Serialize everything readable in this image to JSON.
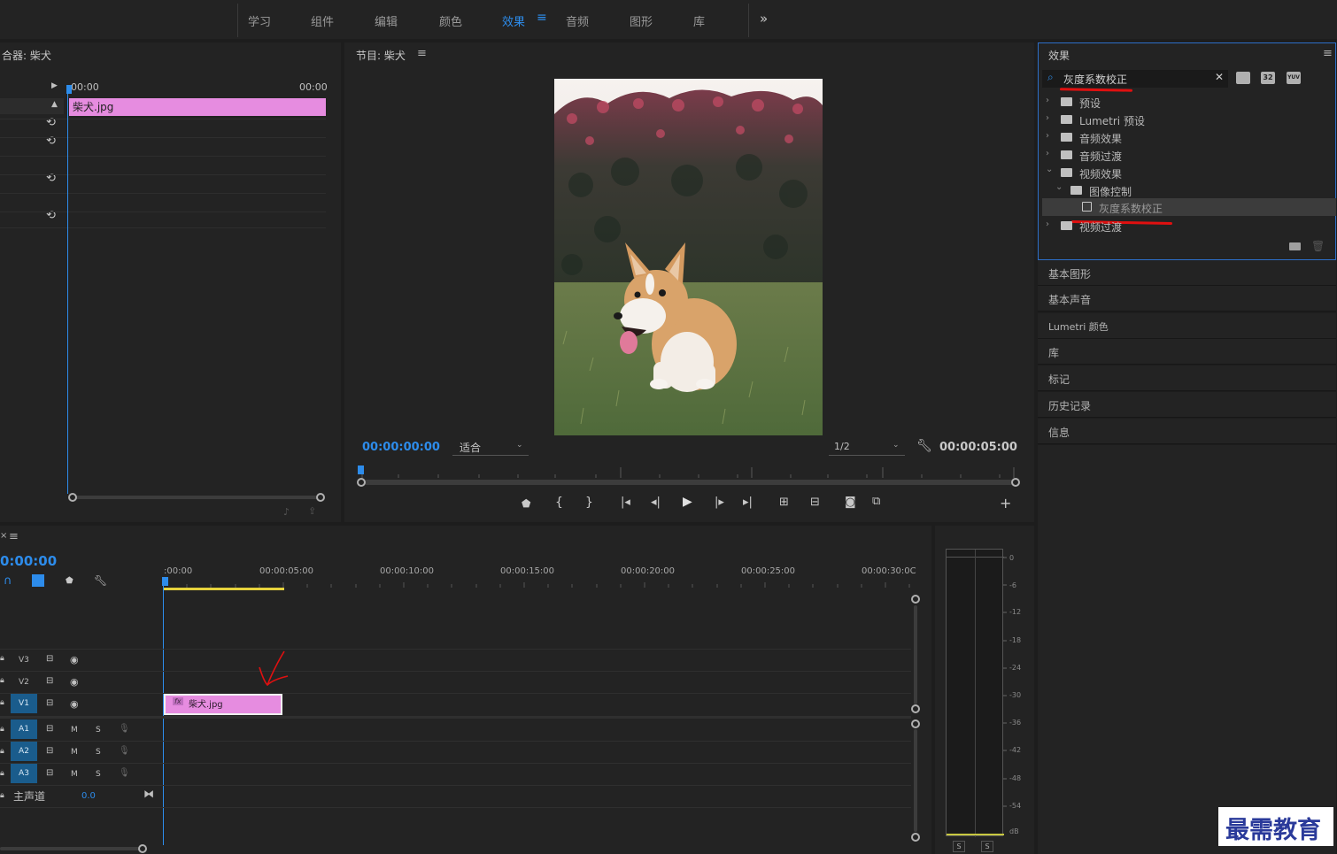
{
  "workspaces": [
    "学习",
    "组件",
    "编辑",
    "颜色",
    "效果",
    "音频",
    "图形",
    "库"
  ],
  "workspace_active_index": 4,
  "workspace_more": "»",
  "effect_controls": {
    "title": "合器: 柴犬",
    "time_left": "00:00",
    "time_right": "00:00",
    "clip_name": "柴犬.jpg"
  },
  "program": {
    "title": "节目: 柴犬",
    "timecode": "00:00:00:00",
    "fit": "适合",
    "resolution": "1/2",
    "duration": "00:00:05:00"
  },
  "effects_panel": {
    "title": "效果",
    "search_value": "灰度系数校正",
    "badge_32": "32",
    "badge_yuv": "YUV",
    "tree": [
      {
        "label": "预设",
        "level": 0,
        "expanded": false
      },
      {
        "label": "Lumetri 预设",
        "level": 0,
        "expanded": false
      },
      {
        "label": "音频效果",
        "level": 0,
        "expanded": false
      },
      {
        "label": "音频过渡",
        "level": 0,
        "expanded": false
      },
      {
        "label": "视频效果",
        "level": 0,
        "expanded": true
      },
      {
        "label": "图像控制",
        "level": 1,
        "expanded": true
      },
      {
        "label": "灰度系数校正",
        "level": 2,
        "selected": true
      },
      {
        "label": "视频过渡",
        "level": 0,
        "expanded": false
      }
    ]
  },
  "side_panels": [
    "基本图形",
    "基本声音",
    "Lumetri 颜色",
    "库",
    "标记",
    "历史记录",
    "信息"
  ],
  "timeline": {
    "timecode": "0:00:00",
    "ruler": [
      ":00:00",
      "00:00:05:00",
      "00:00:10:00",
      "00:00:15:00",
      "00:00:20:00",
      "00:00:25:00",
      "00:00:30:0C"
    ],
    "video_tracks": [
      "V3",
      "V2",
      "V1"
    ],
    "audio_tracks": [
      "A1",
      "A2",
      "A3"
    ],
    "toggle_m": "M",
    "toggle_s": "S",
    "master_label": "主声道",
    "master_value": "0.0",
    "clip_name": "柴犬.jpg",
    "clip_fx": "fx"
  },
  "meter": {
    "labels": [
      "0",
      "-6",
      "-12",
      "-18",
      "-24",
      "-30",
      "-36",
      "-42",
      "-48",
      "-54",
      "dB"
    ],
    "solo_left": "S",
    "solo_right": "S"
  },
  "watermark": "最需教育",
  "colors": {
    "accent_blue": "#2d8ceb",
    "clip_pink": "#e68ce0",
    "annotation_red": "#e01010"
  }
}
